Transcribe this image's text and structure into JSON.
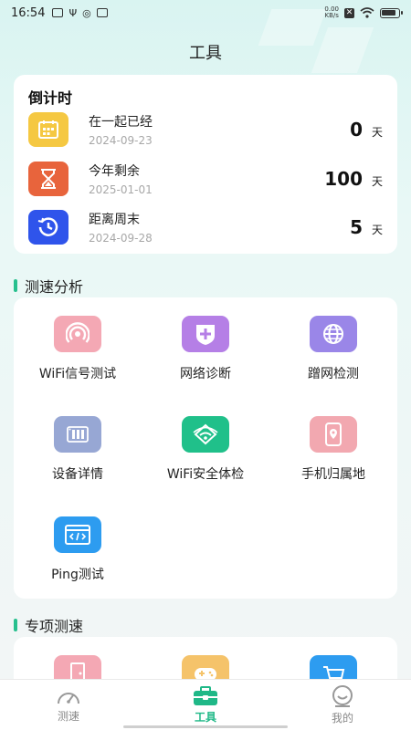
{
  "status_bar": {
    "time": "16:54",
    "net_speed_value": "0.00",
    "net_speed_unit": "KB/s"
  },
  "page": {
    "title": "工具"
  },
  "countdown": {
    "title": "倒计时",
    "items": [
      {
        "name": "在一起已经",
        "date": "2024-09-23",
        "value": "0",
        "unit": "天",
        "icon": "calendar-icon",
        "color": "#f5c842"
      },
      {
        "name": "今年剩余",
        "date": "2025-01-01",
        "value": "100",
        "unit": "天",
        "icon": "hourglass-icon",
        "color": "#e8643c"
      },
      {
        "name": "距离周末",
        "date": "2024-09-28",
        "value": "5",
        "unit": "天",
        "icon": "clock-icon",
        "color": "#2f54eb"
      }
    ]
  },
  "speed_analysis": {
    "title": "测速分析",
    "tools": [
      {
        "label": "WiFi信号测试",
        "icon": "wifi-signal-icon",
        "color": "#f4a8b4"
      },
      {
        "label": "网络诊断",
        "icon": "network-diagnosis-icon",
        "color": "#b57fe6"
      },
      {
        "label": "蹭网检测",
        "icon": "globe-icon",
        "color": "#9a86e8"
      },
      {
        "label": "设备详情",
        "icon": "device-icon",
        "color": "#97a7d4"
      },
      {
        "label": "WiFi安全体检",
        "icon": "wifi-security-icon",
        "color": "#20c08a"
      },
      {
        "label": "手机归属地",
        "icon": "phone-location-icon",
        "color": "#f2a8b0"
      },
      {
        "label": "Ping测试",
        "icon": "ping-icon",
        "color": "#2d9cf0"
      }
    ]
  },
  "special_speed": {
    "title": "专项测速",
    "icons": [
      {
        "icon": "door-icon",
        "color": "#f4a8b4"
      },
      {
        "icon": "gamepad-icon",
        "color": "#f5c36a"
      },
      {
        "icon": "cart-icon",
        "color": "#2d9cf0"
      }
    ]
  },
  "tabbar": {
    "tabs": [
      {
        "label": "测速",
        "icon": "speedometer-icon",
        "active": false
      },
      {
        "label": "工具",
        "icon": "toolbox-icon",
        "active": true
      },
      {
        "label": "我的",
        "icon": "smile-icon",
        "active": false
      }
    ],
    "active_color": "#1fb887"
  }
}
